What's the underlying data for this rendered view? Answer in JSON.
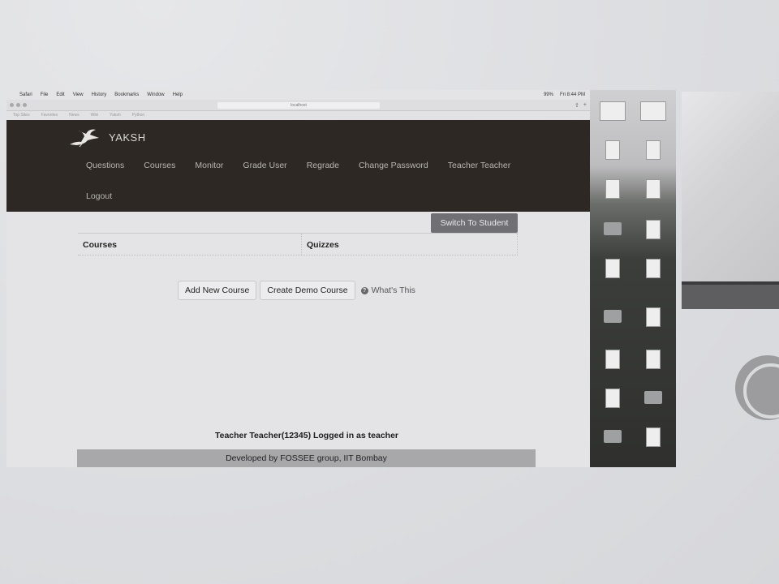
{
  "mac_menubar": {
    "items": [
      "Safari",
      "File",
      "Edit",
      "View",
      "History",
      "Bookmarks",
      "Window",
      "Help"
    ],
    "right": [
      "99%",
      "Fri 8:44 PM"
    ]
  },
  "browser": {
    "url": "localhost",
    "bookmarks": [
      "Top Sites",
      "Favorites",
      "News",
      "Wiki",
      "Yaksh",
      "Python"
    ]
  },
  "navbar": {
    "brand": "YAKSH",
    "links": [
      "Questions",
      "Courses",
      "Monitor",
      "Grade User",
      "Regrade",
      "Change Password",
      "Teacher Teacher"
    ],
    "logout": "Logout"
  },
  "main": {
    "switch_button": "Switch To Student",
    "table_headers": [
      "Courses",
      "Quizzes"
    ],
    "add_course": "Add New Course",
    "create_demo": "Create Demo Course",
    "whats_this": "What's This",
    "login_status": "Teacher Teacher(12345) Logged in as teacher",
    "footer": "Developed by FOSSEE group, IIT Bombay"
  },
  "colors": {
    "navbar_bg": "#2d2824",
    "switch_btn_bg": "#6f6f74",
    "footer_bg": "#a8a8aa"
  }
}
